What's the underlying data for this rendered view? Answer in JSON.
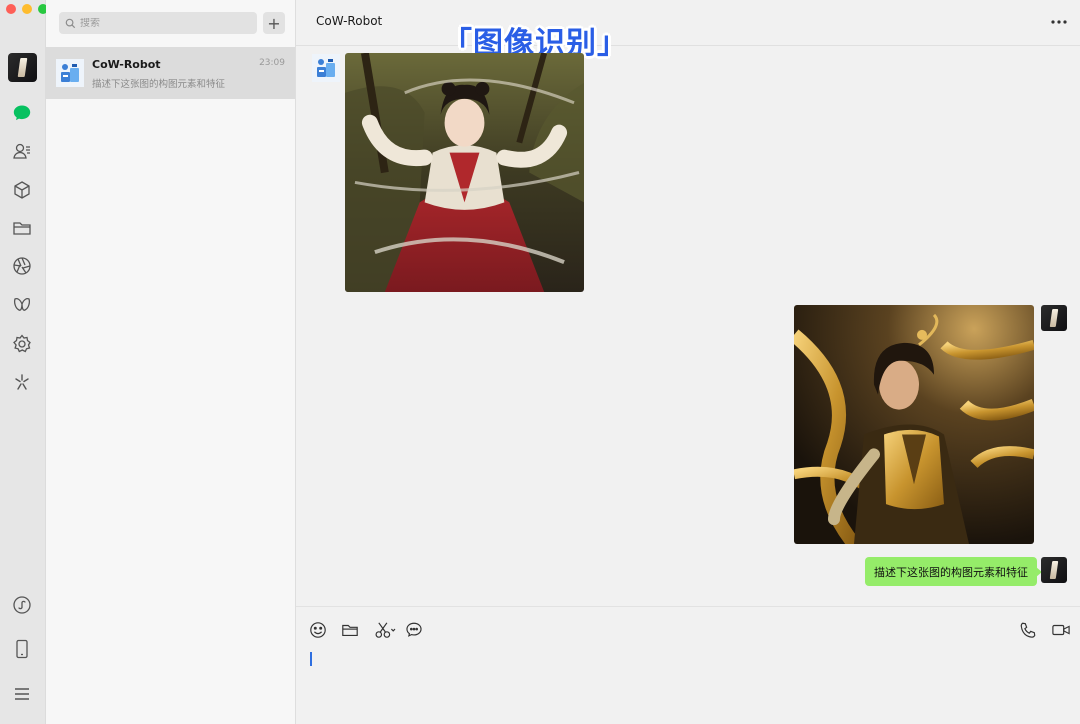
{
  "window": {
    "controls": [
      "close",
      "minimize",
      "zoom"
    ]
  },
  "sidebar_rail": {
    "icons": [
      "chat-icon",
      "contacts-icon",
      "favorites-cube-icon",
      "files-folder-icon",
      "moments-aperture-icon",
      "channels-butterfly-icon",
      "mini-programs-gear-icon",
      "search-spark-icon",
      "mini-program-link-icon",
      "phone-icon",
      "menu-icon"
    ],
    "active": "chat-icon",
    "active_color": "#07c160"
  },
  "search": {
    "placeholder": "搜索",
    "add_label": "+"
  },
  "conversations": [
    {
      "name": "CoW-Robot",
      "time": "23:09",
      "preview": "描述下这张图的构图元素和特征"
    }
  ],
  "chat": {
    "title": "CoW-Robot",
    "banner": "「图像识别」",
    "messages": [
      {
        "sender": "bot",
        "type": "image",
        "description": "girl in red and white hanfu with ribbons in a forest"
      },
      {
        "sender": "me",
        "type": "image",
        "description": "girl in golden armor-like hanfu with golden ribbons"
      },
      {
        "sender": "me",
        "type": "text",
        "text": "描述下这张图的构图元素和特征"
      }
    ],
    "bubble_color": "#95ec69"
  },
  "composer": {
    "tools_left": [
      "emoji-icon",
      "folder-icon",
      "screenshot-scissors-icon",
      "chat-history-icon"
    ],
    "tools_right": [
      "voice-call-icon",
      "video-call-icon"
    ],
    "caret_color": "#2f6fe0"
  }
}
